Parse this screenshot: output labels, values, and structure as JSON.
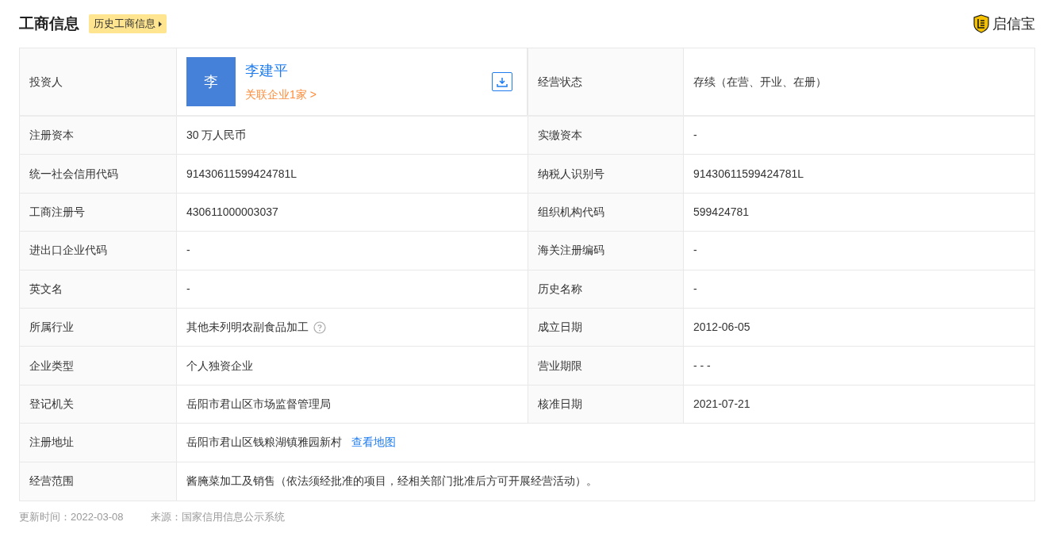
{
  "header": {
    "title": "工商信息",
    "history_button": "历史工商信息",
    "brand": "启信宝"
  },
  "investor": {
    "label": "投资人",
    "avatar": "李",
    "name": "李建平",
    "related": "关联企业1家 >",
    "status_label": "经营状态",
    "status_value": "存续（在营、开业、在册）"
  },
  "rows": [
    {
      "cells": [
        {
          "label": "注册资本",
          "value": "30 万人民币"
        },
        {
          "label": "实缴资本",
          "value": "-"
        }
      ]
    },
    {
      "cells": [
        {
          "label": "统一社会信用代码",
          "value": "91430611599424781L"
        },
        {
          "label": "纳税人识别号",
          "value": "91430611599424781L"
        }
      ]
    },
    {
      "cells": [
        {
          "label": "工商注册号",
          "value": "430611000003037"
        },
        {
          "label": "组织机构代码",
          "value": "599424781"
        }
      ]
    },
    {
      "cells": [
        {
          "label": "进出口企业代码",
          "value": "-"
        },
        {
          "label": "海关注册编码",
          "value": "-"
        }
      ]
    },
    {
      "cells": [
        {
          "label": "英文名",
          "value": "-"
        },
        {
          "label": "历史名称",
          "value": "-"
        }
      ]
    },
    {
      "cells": [
        {
          "label": "所属行业",
          "value": "其他未列明农副食品加工",
          "help": true
        },
        {
          "label": "成立日期",
          "value": "2012-06-05"
        }
      ]
    },
    {
      "cells": [
        {
          "label": "企业类型",
          "value": "个人独资企业"
        },
        {
          "label": "营业期限",
          "value": "- - -"
        }
      ]
    },
    {
      "cells": [
        {
          "label": "登记机关",
          "value": "岳阳市君山区市场监督管理局"
        },
        {
          "label": "核准日期",
          "value": "2021-07-21"
        }
      ]
    },
    {
      "cells": [
        {
          "label": "注册地址",
          "value": "岳阳市君山区钱粮湖镇雅园新村",
          "link": "查看地图"
        }
      ]
    },
    {
      "cells": [
        {
          "label": "经营范围",
          "value": "酱腌菜加工及销售（依法须经批准的项目，经相关部门批准后方可开展经营活动）。"
        }
      ]
    }
  ],
  "footer": {
    "updated": "更新时间：2022-03-08",
    "source": "来源：国家信用信息公示系统"
  }
}
